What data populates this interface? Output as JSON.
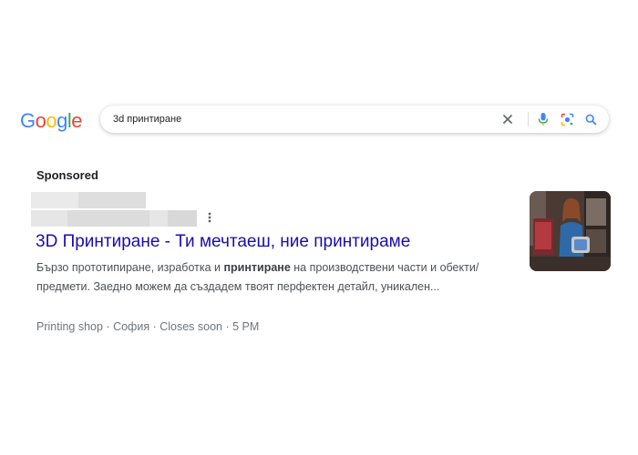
{
  "logo": {
    "letters": [
      "G",
      "o",
      "o",
      "g",
      "l",
      "e"
    ],
    "colors": [
      "#4285F4",
      "#EA4335",
      "#FBBC05",
      "#4285F4",
      "#34A853",
      "#EA4335"
    ]
  },
  "search": {
    "query": "3d принтиране"
  },
  "ad": {
    "sponsored_label": "Sponsored",
    "title": "3D Принтиране - Ти мечтаеш, ние принтираме",
    "description": {
      "part1": "Бързо прототипиране, изработка и ",
      "bold": "принтиране",
      "part2": " на производствени части и обекти/предмети. Заедно можем да създадем твоят перфектен детайл, уникален..."
    },
    "meta": {
      "category": "Printing shop",
      "location": "София",
      "status": "Closes soon",
      "time": "5 PM",
      "separator": " · "
    }
  },
  "colors": {
    "link": "#1a0dab",
    "text": "#4d5156",
    "meta": "#70757a",
    "icon_blue": "#4285F4"
  }
}
